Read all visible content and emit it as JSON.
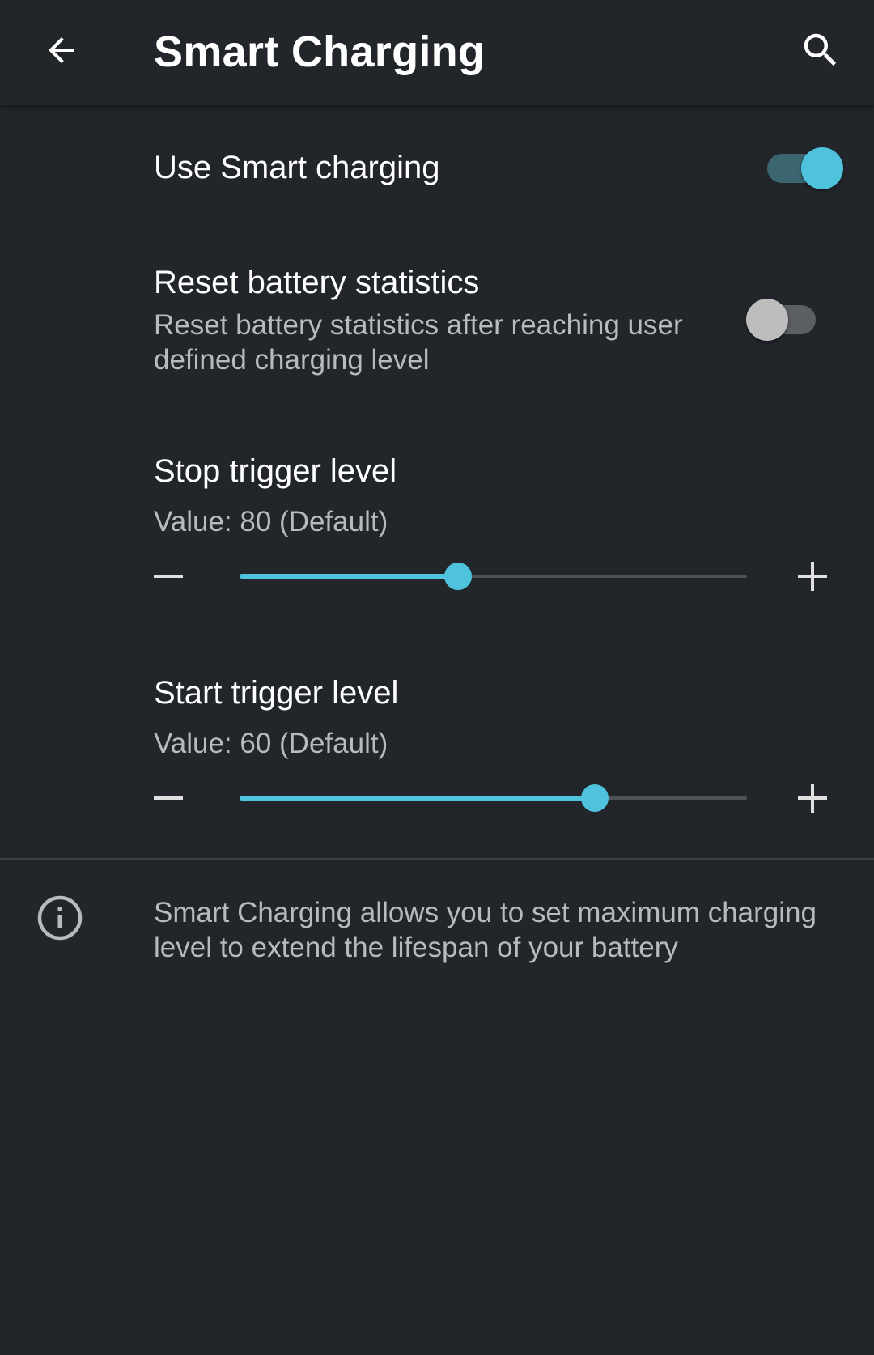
{
  "appbar": {
    "title": "Smart Charging",
    "back_icon": "arrow-back-icon",
    "search_icon": "search-icon"
  },
  "preferences": {
    "use_smart_charging": {
      "title": "Use Smart charging",
      "enabled": true
    },
    "reset_battery_statistics": {
      "title": "Reset battery statistics",
      "summary": "Reset battery statistics after reaching user defined charging level",
      "enabled": false
    },
    "stop_trigger_level": {
      "title": "Stop trigger level",
      "summary": "Value: 80 (Default)",
      "slider_fraction": 0.43
    },
    "start_trigger_level": {
      "title": "Start trigger level",
      "summary": "Value: 60 (Default)",
      "slider_fraction": 0.7
    }
  },
  "info": {
    "icon": "info-icon",
    "text": "Smart Charging allows you to set maximum charging level to extend the lifespan of your battery"
  },
  "colors": {
    "background": "#22262b",
    "accent": "#4fc3dd",
    "secondary_text": "#b6bbc0"
  }
}
